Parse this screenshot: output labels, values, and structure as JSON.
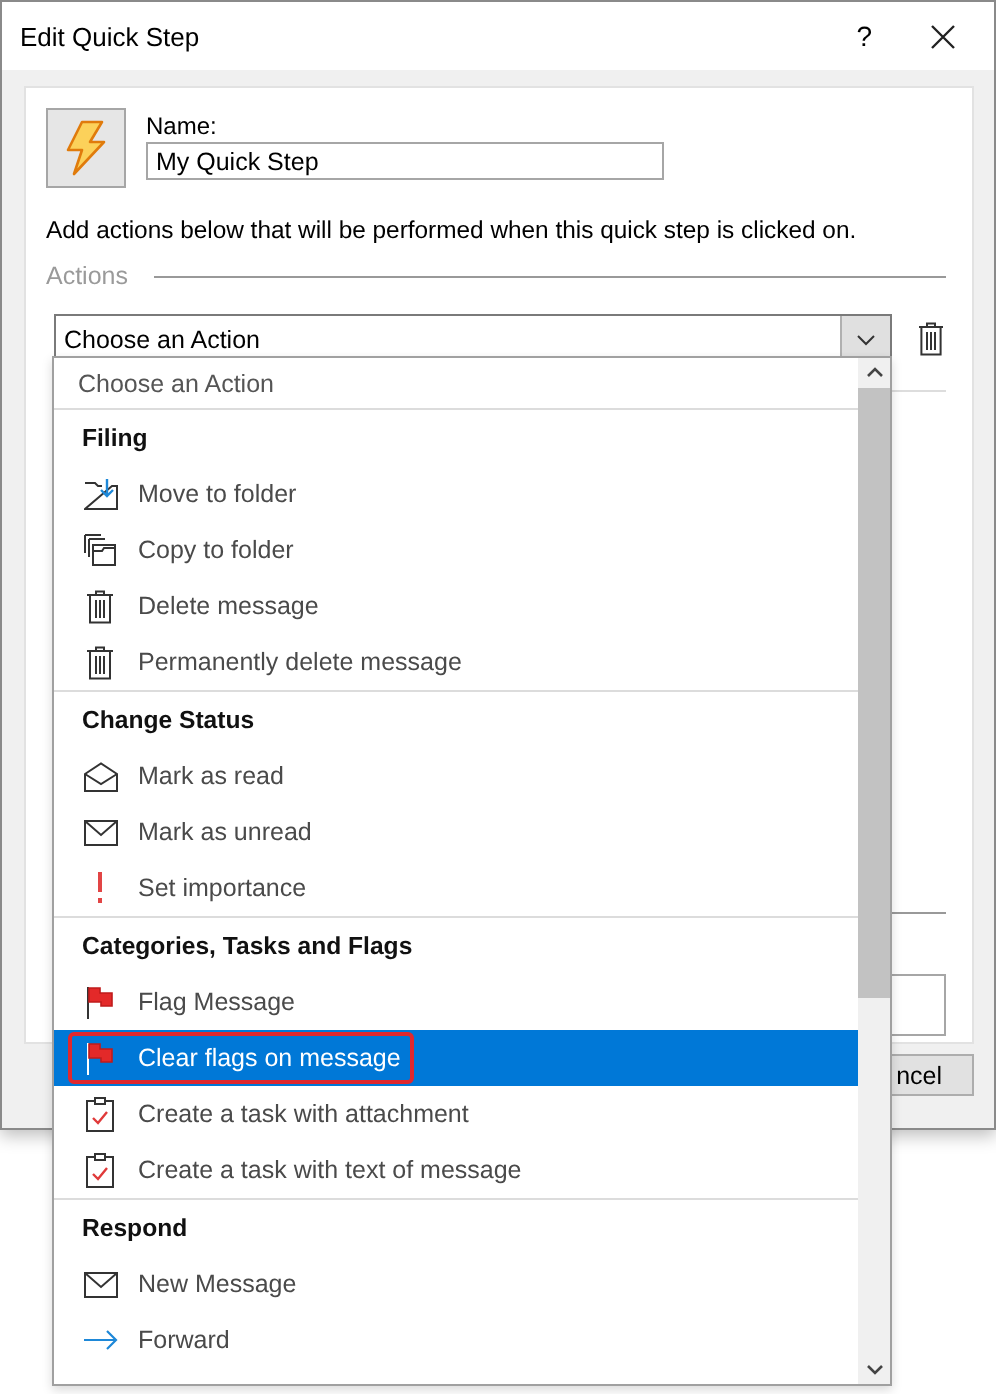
{
  "window": {
    "title": "Edit Quick Step",
    "help": "?"
  },
  "quick_step": {
    "name_label": "Name:",
    "name_value": "My Quick Step"
  },
  "instructions": "Add actions below that will be performed when this quick step is clicked on.",
  "actions_label": "Actions",
  "action_select": {
    "value": "Choose an Action",
    "expanded": true
  },
  "background_fragments": {
    "cancel_button": "ncel"
  },
  "dropdown": {
    "first_option": {
      "label": "Choose an Action",
      "selected": false
    },
    "sections": [
      {
        "heading": "Filing",
        "items": [
          {
            "label": "Move to folder",
            "kind": "move",
            "selected": false
          },
          {
            "label": "Copy to folder",
            "kind": "copy",
            "selected": false
          },
          {
            "label": "Delete message",
            "kind": "delete",
            "selected": false
          },
          {
            "label": "Permanently delete message",
            "kind": "delete",
            "selected": false
          }
        ]
      },
      {
        "heading": "Change Status",
        "items": [
          {
            "label": "Mark as read",
            "kind": "read",
            "selected": false
          },
          {
            "label": "Mark as unread",
            "kind": "unread",
            "selected": false
          },
          {
            "label": "Set importance",
            "kind": "importance",
            "selected": false
          }
        ]
      },
      {
        "heading": "Categories, Tasks and Flags",
        "items": [
          {
            "label": "Flag Message",
            "kind": "flag",
            "selected": false
          },
          {
            "label": "Clear flags on message",
            "kind": "flag",
            "selected": true
          },
          {
            "label": "Create a task with attachment",
            "kind": "task",
            "selected": false
          },
          {
            "label": "Create a task with text of message",
            "kind": "task",
            "selected": false
          }
        ]
      },
      {
        "heading": "Respond",
        "items": [
          {
            "label": "New Message",
            "kind": "message",
            "selected": false
          },
          {
            "label": "Forward",
            "kind": "forward",
            "selected": false
          }
        ]
      }
    ]
  }
}
